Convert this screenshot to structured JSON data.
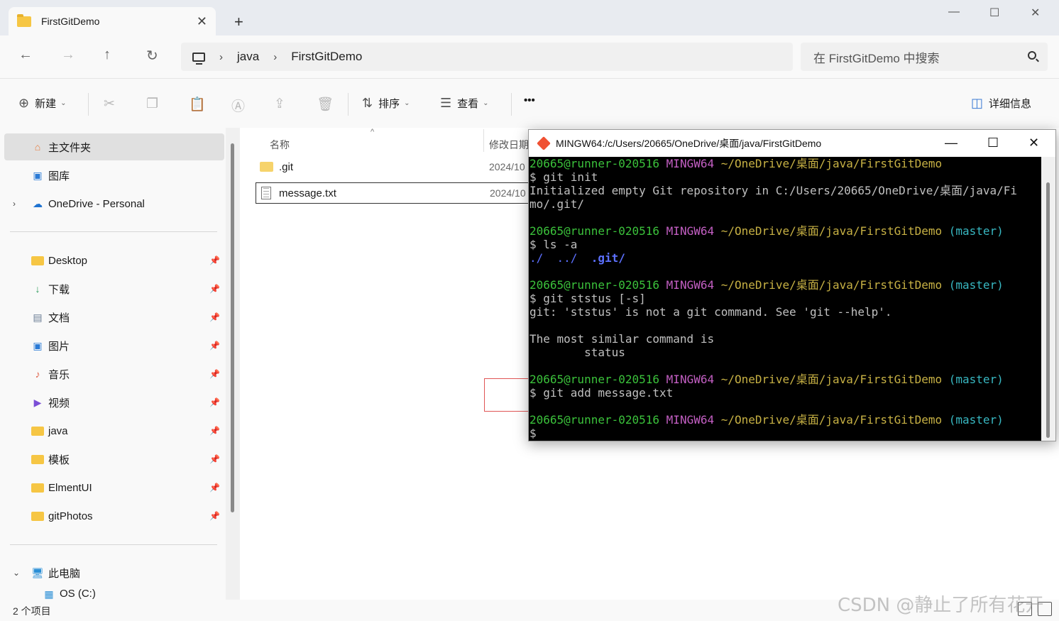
{
  "window": {
    "tab_title": "FirstGitDemo",
    "new_tab": "+"
  },
  "nav": {
    "path": [
      "java",
      "FirstGitDemo"
    ],
    "search_placeholder": "在 FirstGitDemo 中搜索"
  },
  "toolbar": {
    "new_label": "新建",
    "sort_label": "排序",
    "view_label": "查看",
    "more_label": "•••",
    "details_label": "详细信息"
  },
  "sidebar": {
    "home": "主文件夹",
    "gallery": "图库",
    "onedrive": "OneDrive - Personal",
    "quick": [
      "Desktop",
      "下载",
      "文档",
      "图片",
      "音乐",
      "视频",
      "java",
      "模板",
      "ElmentUI",
      "gitPhotos"
    ],
    "this_pc": "此电脑",
    "os_drive": "OS (C:)"
  },
  "content": {
    "col_name": "名称",
    "col_date": "修改日期",
    "files": [
      {
        "name": ".git",
        "date": "2024/10"
      },
      {
        "name": "message.txt",
        "date": "2024/10"
      }
    ]
  },
  "status": {
    "count": "2 个项目"
  },
  "watermark": "CSDN @静止了所有花开",
  "terminal": {
    "title": "MINGW64:/c/Users/20665/OneDrive/桌面/java/FirstGitDemo",
    "user": "20665@runner-020516",
    "env": "MINGW64",
    "path": "~/OneDrive/桌面/java/FirstGitDemo",
    "branch": "(master)",
    "cmd1": "$ git init",
    "out1a": "Initialized empty Git repository in C:/Users/20665/OneDrive/桌面/java/Fi",
    "out1b": "mo/.git/",
    "cmd2": "$ ls -a",
    "out2a": "./  ../  ",
    "out2b": ".git/",
    "cmd3": "$ git ststus [-s]",
    "out3a": "git: 'ststus' is not a git command. See 'git --help'.",
    "out3b": "The most similar command is",
    "out3c": "        status",
    "cmd4": "$ git add message.txt",
    "prompt": "$"
  },
  "colors": {
    "terminal_user": "#3bc23b",
    "terminal_env": "#c35fc3",
    "terminal_path": "#c7b144",
    "terminal_branch": "#38b8c2",
    "annotation_box": "#e05555"
  }
}
